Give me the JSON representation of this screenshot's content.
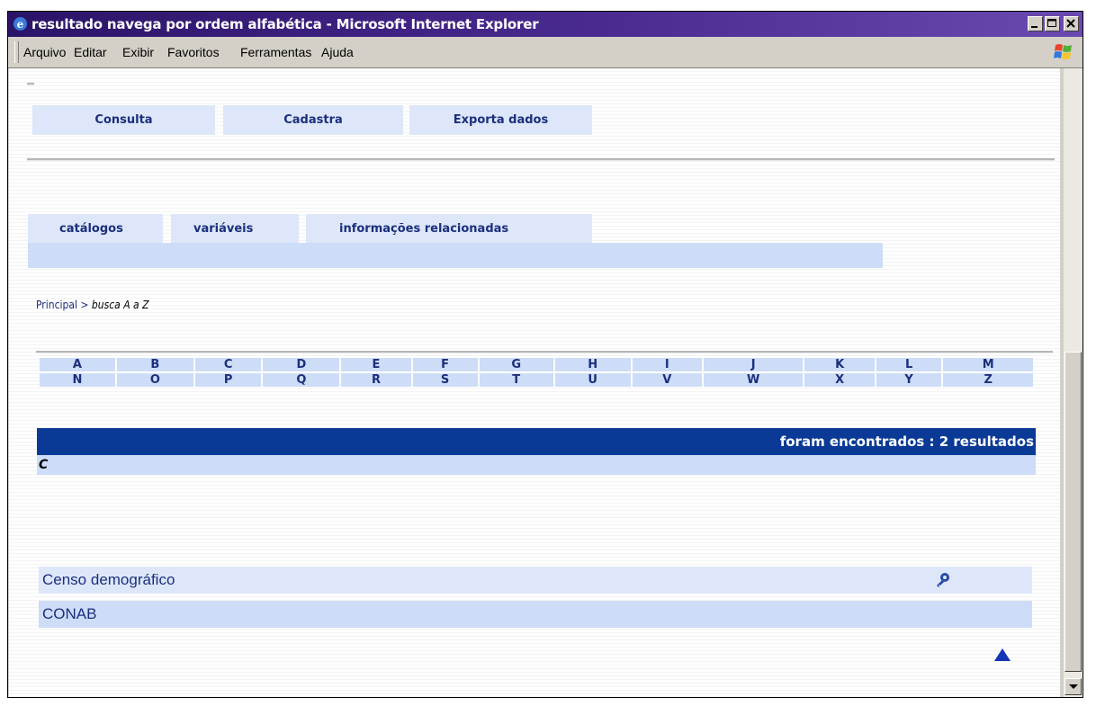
{
  "window": {
    "title": "resultado navega por ordem alfabética - Microsoft Internet Explorer",
    "icon": "ie-icon",
    "controls": [
      "minimize-icon",
      "maximize-icon",
      "close-icon"
    ]
  },
  "menubar": {
    "items": [
      "Arquivo",
      "Editar",
      "Exibir",
      "Favoritos",
      "Ferramentas",
      "Ajuda"
    ]
  },
  "topnav": {
    "tabs": [
      "Consulta",
      "Cadastra",
      "Exporta dados"
    ]
  },
  "subnav": {
    "tabs": [
      "catálogos",
      "variáveis",
      "informações relacionadas"
    ]
  },
  "breadcrumb": {
    "root": "Principal",
    "separator": ">",
    "current": "busca A a Z"
  },
  "alphabet": {
    "row1": [
      "A",
      "B",
      "C",
      "D",
      "E",
      "F",
      "G",
      "H",
      "I",
      "J",
      "K",
      "L",
      "M"
    ],
    "row2": [
      "N",
      "O",
      "P",
      "Q",
      "R",
      "S",
      "T",
      "U",
      "V",
      "W",
      "X",
      "Y",
      "Z"
    ]
  },
  "results": {
    "summary": "foram encontrados : 2 resultados",
    "letter": "C",
    "items": [
      {
        "name": "Censo demográfico",
        "has_key_icon": true
      },
      {
        "name": "CONAB",
        "has_key_icon": false
      }
    ]
  },
  "colors": {
    "accent_dark": "#0a3a96",
    "tab_bg": "#dde7f9",
    "row_bg": "#cddcf7",
    "link": "#1c2f7c",
    "titlebar": "#2a1468"
  },
  "icons": {
    "back_to_top": "triangle-up-icon",
    "result_detail": "key-icon"
  }
}
